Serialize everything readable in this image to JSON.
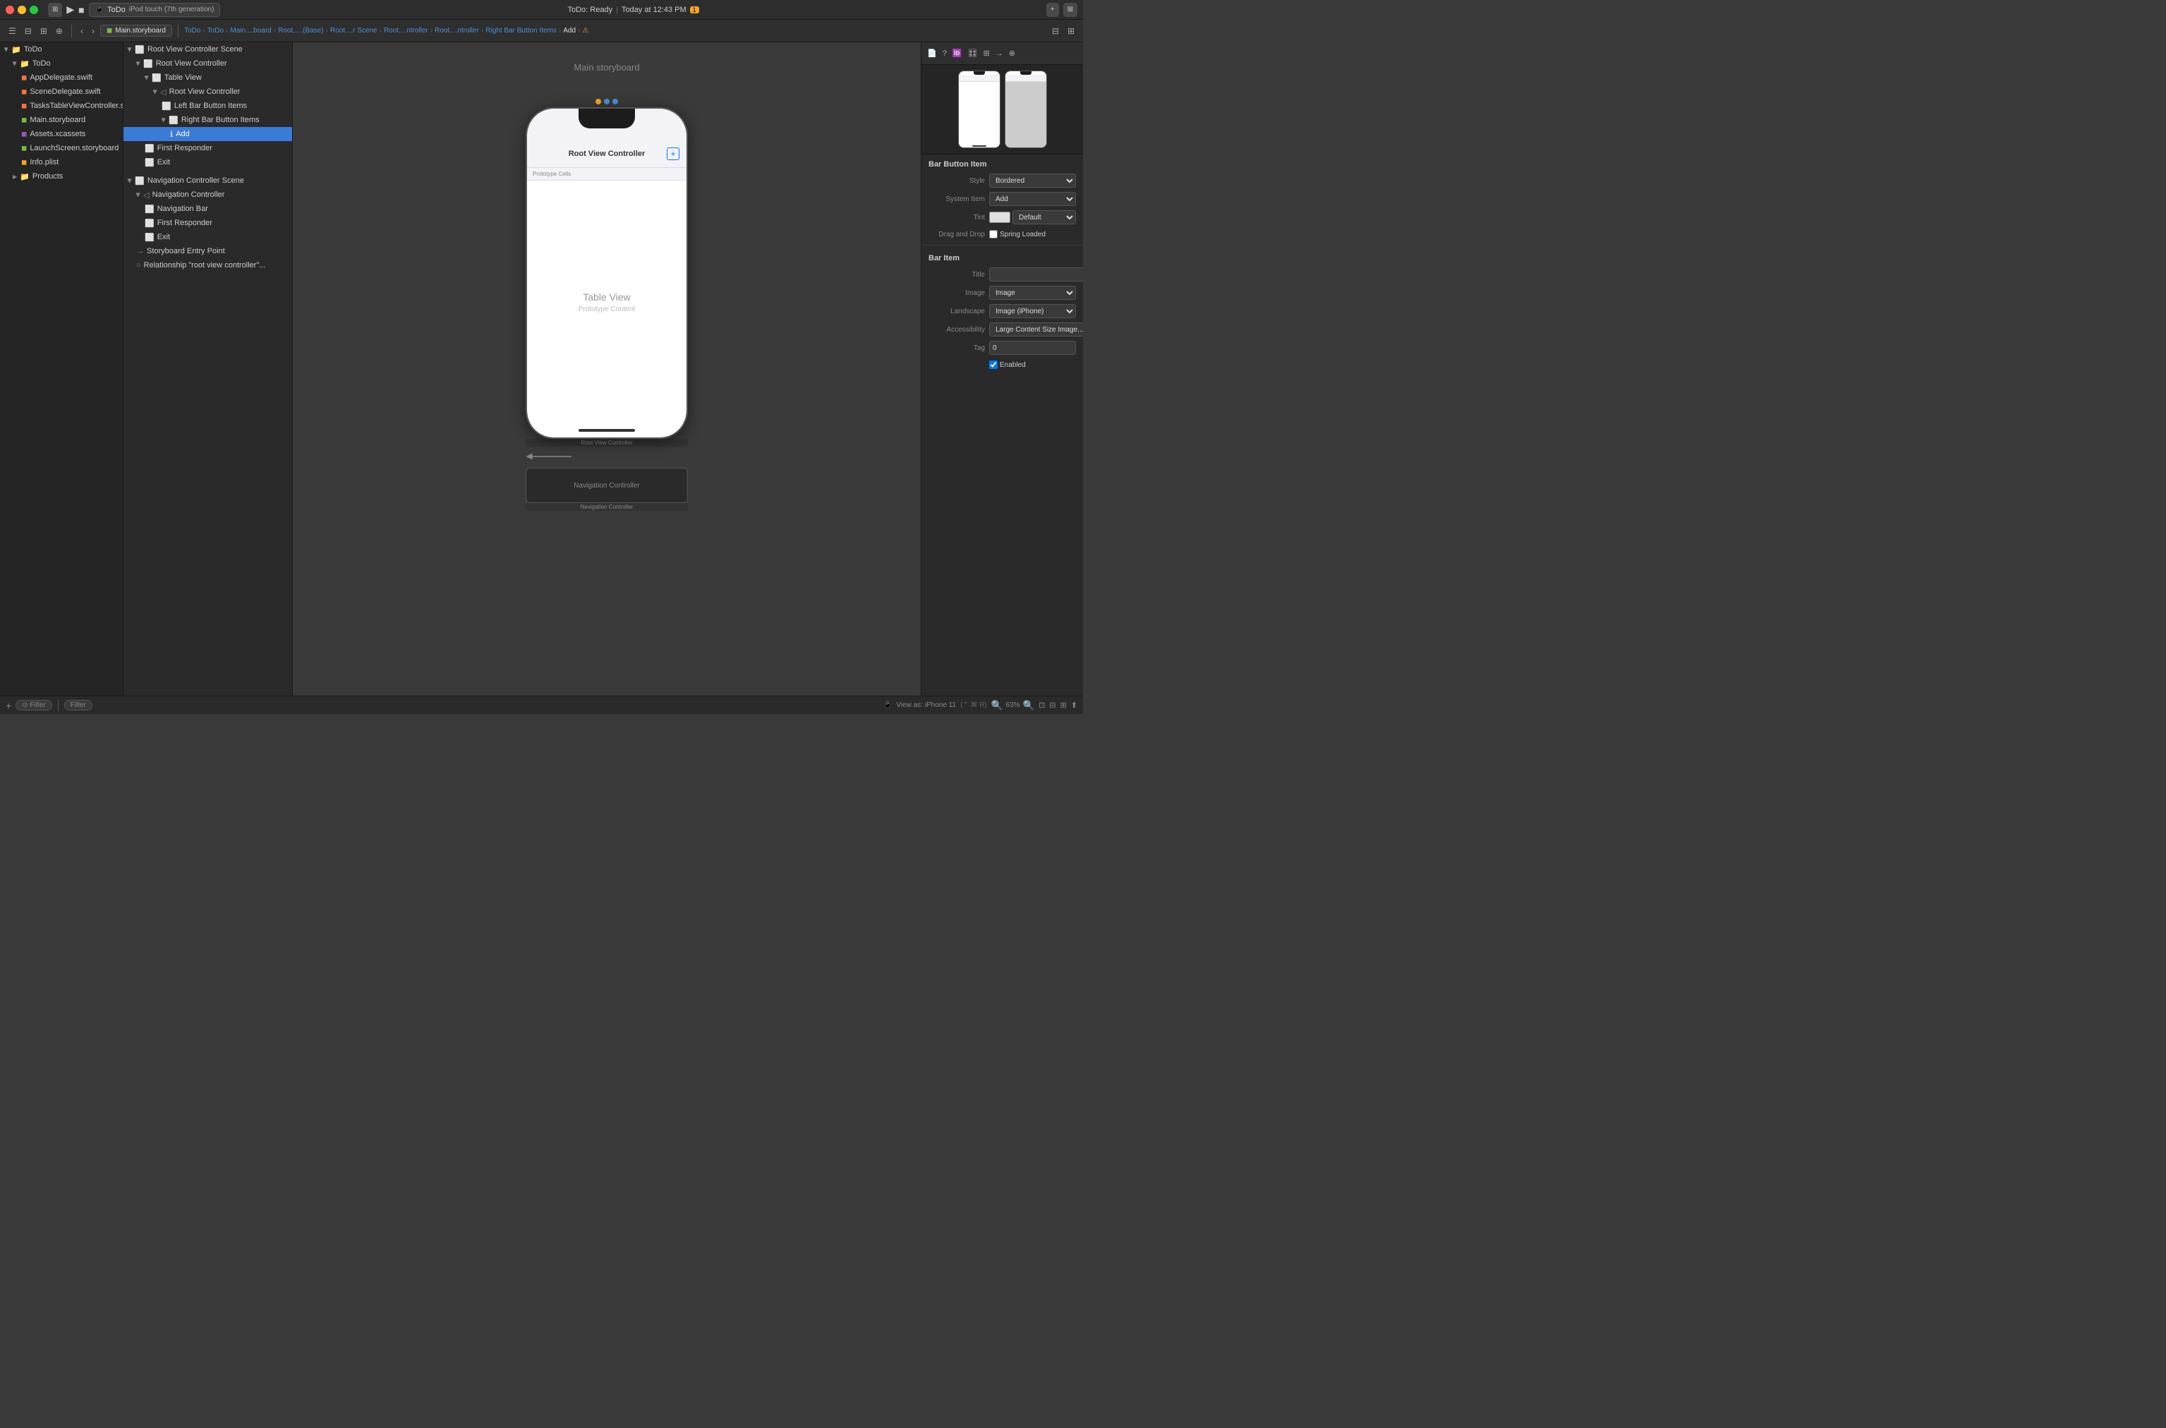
{
  "titleBar": {
    "trafficLights": [
      "red",
      "yellow",
      "green"
    ],
    "schemeLabel": "ToDo",
    "deviceLabel": "iPod touch (7th generation)",
    "statusLabel": "ToDo: Ready",
    "timestampLabel": "Today at 12:43 PM",
    "warningCount": "1",
    "addBtn": "+",
    "layoutBtn": "⊞"
  },
  "toolbar": {
    "backBtn": "‹",
    "forwardBtn": "›",
    "fileLabel": "Main.storyboard",
    "breadcrumbs": [
      "ToDo",
      "ToDo",
      "Main....board",
      "Root.....(Base)",
      "Root....r Scene",
      "Root....ntroller",
      "Root....ntroller",
      "Right Bar Button Items",
      "Add"
    ]
  },
  "fileNav": {
    "rootLabel": "ToDo",
    "groups": [
      {
        "name": "ToDo",
        "expanded": true,
        "items": [
          {
            "name": "AppDelegate.swift",
            "type": "swift"
          },
          {
            "name": "SceneDelegate.swift",
            "type": "swift"
          },
          {
            "name": "TasksTableViewController.swift",
            "type": "swift"
          },
          {
            "name": "Main.storyboard",
            "type": "storyboard"
          },
          {
            "name": "Assets.xcassets",
            "type": "xcassets"
          },
          {
            "name": "LaunchScreen.storyboard",
            "type": "storyboard"
          },
          {
            "name": "Info.plist",
            "type": "plist"
          }
        ]
      },
      {
        "name": "Products",
        "expanded": false,
        "items": []
      }
    ]
  },
  "outline": {
    "sections": [
      {
        "title": "",
        "items": [
          {
            "label": "Root View Controller Scene",
            "indent": 0,
            "type": "scene",
            "expanded": true
          },
          {
            "label": "Root View Controller",
            "indent": 1,
            "type": "vc",
            "expanded": true
          },
          {
            "label": "Table View",
            "indent": 2,
            "type": "tableview",
            "expanded": true
          },
          {
            "label": "Root View Controller",
            "indent": 3,
            "type": "vc2",
            "expanded": true
          },
          {
            "label": "Left Bar Button Items",
            "indent": 4,
            "type": "items"
          },
          {
            "label": "Right Bar Button Items",
            "indent": 4,
            "type": "items",
            "expanded": true
          },
          {
            "label": "Add",
            "indent": 5,
            "type": "add",
            "selected": true
          },
          {
            "label": "First Responder",
            "indent": 2,
            "type": "responder"
          },
          {
            "label": "Exit",
            "indent": 2,
            "type": "exit"
          }
        ]
      },
      {
        "title": "",
        "items": [
          {
            "label": "Navigation Controller Scene",
            "indent": 0,
            "type": "scene",
            "expanded": true
          },
          {
            "label": "Navigation Controller",
            "indent": 1,
            "type": "navctrl",
            "expanded": true
          },
          {
            "label": "Navigation Bar",
            "indent": 2,
            "type": "navbar"
          },
          {
            "label": "First Responder",
            "indent": 2,
            "type": "responder"
          },
          {
            "label": "Exit",
            "indent": 2,
            "type": "exit"
          },
          {
            "label": "Storyboard Entry Point",
            "indent": 1,
            "type": "entry"
          },
          {
            "label": "Relationship \"root view controller\"...",
            "indent": 1,
            "type": "relationship"
          }
        ]
      }
    ]
  },
  "canvas": {
    "storyboardLabel": "Main storyboard",
    "rootScene": {
      "navBarTitle": "Root View Controller",
      "prototypeCells": "Prototype Cells",
      "tableViewLabel": "Table View",
      "prototypeContent": "Prototype Content",
      "sceneLabelBottom": "Root View Controller"
    },
    "navScene": {
      "label": "Navigation Controller",
      "bottomLabel": "Navigation Controller"
    }
  },
  "inspector": {
    "sectionTitle": "Bar Button Item",
    "subTitle": "Bar Item",
    "rows": [
      {
        "label": "Style",
        "value": "Bordered",
        "type": "select"
      },
      {
        "label": "System Item",
        "value": "Add",
        "type": "select"
      },
      {
        "label": "Tint",
        "value": "Default",
        "type": "color-select"
      },
      {
        "label": "Drag and Drop",
        "value": "",
        "type": "checkbox-label",
        "checkboxLabel": "Spring Loaded"
      }
    ],
    "barItemRows": [
      {
        "label": "Title",
        "value": "",
        "type": "text"
      },
      {
        "label": "Image",
        "value": "Image",
        "type": "select"
      },
      {
        "label": "Landscape",
        "value": "Image (iPhone)",
        "type": "select"
      },
      {
        "label": "Accessibility",
        "value": "Large Content Size Image...",
        "type": "select"
      },
      {
        "label": "Tag",
        "value": "0",
        "type": "number"
      },
      {
        "label": "",
        "value": "Enabled",
        "type": "checkbox",
        "checked": true
      }
    ]
  },
  "statusBar": {
    "addBtn": "+",
    "filterLeft": "Filter",
    "filterRight": "Filter",
    "viewAs": "View as: iPhone 11",
    "shortcut": "(⌃ ⌘ R)",
    "zoom": "63%"
  }
}
